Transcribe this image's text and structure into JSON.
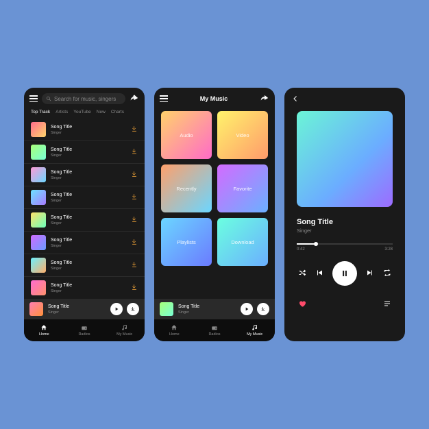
{
  "screen1": {
    "search_placeholder": "Search for music, singers",
    "tabs": [
      "Top Track",
      "Artists",
      "YouTube",
      "New",
      "Charts"
    ],
    "songs": [
      {
        "title": "Song Title",
        "singer": "Singer",
        "grad": "g1"
      },
      {
        "title": "Song Title",
        "singer": "Singer",
        "grad": "g2"
      },
      {
        "title": "Song Title",
        "singer": "Singer",
        "grad": "g3"
      },
      {
        "title": "Song Title",
        "singer": "Singer",
        "grad": "g4"
      },
      {
        "title": "Song Title",
        "singer": "Singer",
        "grad": "g5"
      },
      {
        "title": "Song Title",
        "singer": "Singer",
        "grad": "g6"
      },
      {
        "title": "Song Title",
        "singer": "Singer",
        "grad": "g7"
      },
      {
        "title": "Song Title",
        "singer": "Singer",
        "grad": "g8"
      }
    ],
    "miniplayer": {
      "title": "Song Title",
      "singer": "Singer",
      "grad": "g9"
    },
    "nav": {
      "home": "Home",
      "radios": "Radios",
      "mymusic": "My Music"
    }
  },
  "screen2": {
    "title": "My Music",
    "categories": [
      {
        "label": "Audio",
        "grad": "g10"
      },
      {
        "label": "Video",
        "grad": "g11"
      },
      {
        "label": "Recently",
        "grad": "g12"
      },
      {
        "label": "Favorite",
        "grad": "g13"
      },
      {
        "label": "Playlists",
        "grad": "g14"
      },
      {
        "label": "Download",
        "grad": "g15"
      }
    ],
    "miniplayer": {
      "title": "Song Title",
      "singer": "Singer",
      "grad": "g2"
    },
    "nav": {
      "home": "Home",
      "radios": "Radios",
      "mymusic": "My Music"
    }
  },
  "screen3": {
    "title": "Song Title",
    "singer": "Singer",
    "time_current": "0:42",
    "time_total": "3:28"
  }
}
